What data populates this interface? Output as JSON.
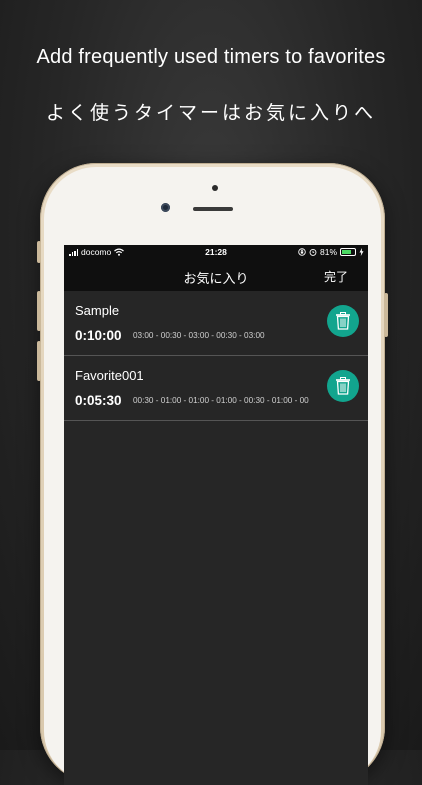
{
  "banner": {
    "headline": "Add frequently used timers to favorites",
    "subheadline": "よく使うタイマーはお気に入りへ"
  },
  "status_bar": {
    "carrier": "docomo",
    "time": "21:28",
    "battery_percent": "81%",
    "battery_level": 0.81,
    "icons": [
      "signal-bars-icon",
      "wifi-icon",
      "orientation-lock-icon",
      "alarm-icon",
      "battery-icon",
      "charging-icon"
    ]
  },
  "nav_bar": {
    "title": "お気に入り",
    "done_label": "完了"
  },
  "favorites": [
    {
      "name": "Sample",
      "total": "0:10:00",
      "sequence": "03:00 - 00:30 - 03:00 - 00:30 - 03:00"
    },
    {
      "name": "Favorite001",
      "total": "0:05:30",
      "sequence": "00:30 - 01:00 - 01:00 - 01:00 - 00:30 - 01:00 - 00"
    }
  ],
  "colors": {
    "background": "#262626",
    "accent": "#12a58e",
    "bar": "#0f0f0f",
    "battery": "#4cd964"
  }
}
